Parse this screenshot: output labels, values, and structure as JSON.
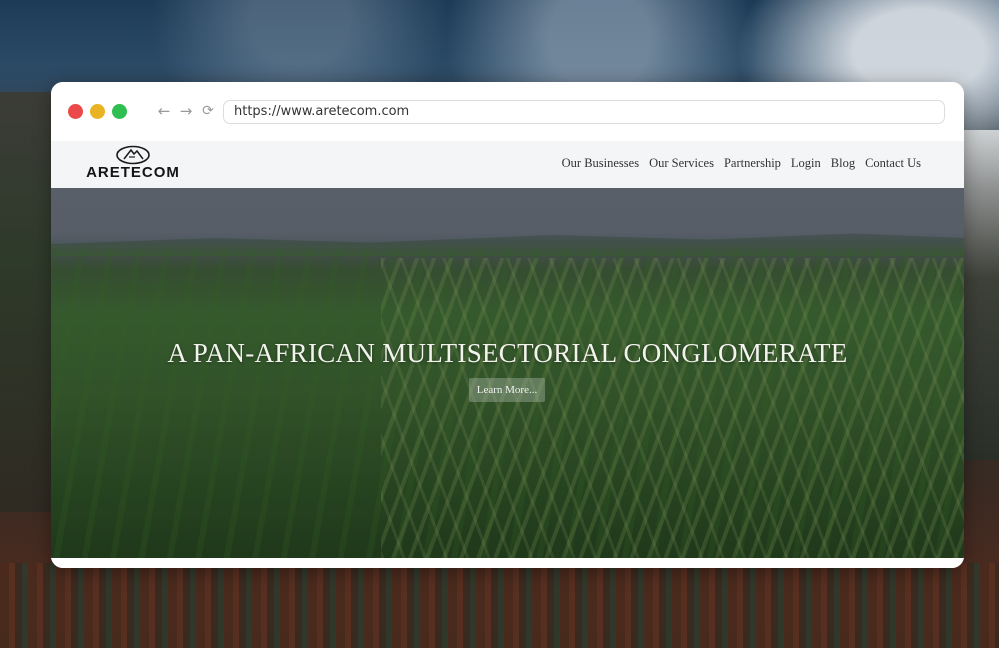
{
  "browser": {
    "url": "https://www.aretecom.com",
    "traffic_lights": [
      "#ec4a4a",
      "#e9b324",
      "#2fbe50"
    ],
    "icons": {
      "back": "arrow-left-icon",
      "forward": "arrow-right-icon",
      "reload": "reload-icon"
    }
  },
  "site": {
    "logo_text": "ARETECOM",
    "nav": [
      "Our Businesses",
      "Our Services",
      "Partnership",
      "Login",
      "Blog",
      "Contact Us"
    ],
    "hero_title": "A PAN-AFRICAN MULTISECTORIAL CONGLOMERATE",
    "hero_button": "Learn More..."
  }
}
